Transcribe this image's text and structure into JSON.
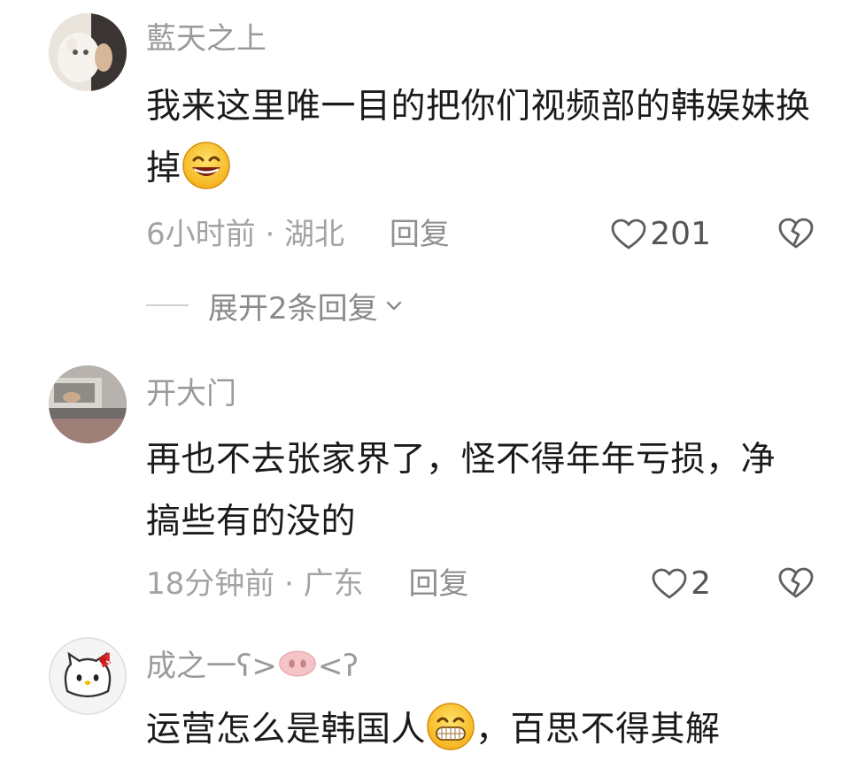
{
  "comments": [
    {
      "username": "藍天之上",
      "text": "我来这里唯一目的把你们视频部的韩娱妹换掉",
      "emoji": "grin-emoji",
      "time_location": "6小时前 · 湖北",
      "reply_label": "回复",
      "likes": "201",
      "expand_label": "展开2条回复"
    },
    {
      "username": "开大门",
      "text": "再也不去张家界了，怪不得年年亏损，净搞些有的没的",
      "time_location": "18分钟前 · 广东",
      "reply_label": "回复",
      "likes": "2"
    },
    {
      "username_prefix": "成之一ʕ>",
      "username_suffix": "<ʔ",
      "text_part1": "运营怎么是韩国人",
      "text_part2": "，百思不得其解"
    }
  ],
  "colors": {
    "text": "#1a1a1a",
    "muted": "#9a9a9a",
    "icon": "#5e5e5e"
  }
}
